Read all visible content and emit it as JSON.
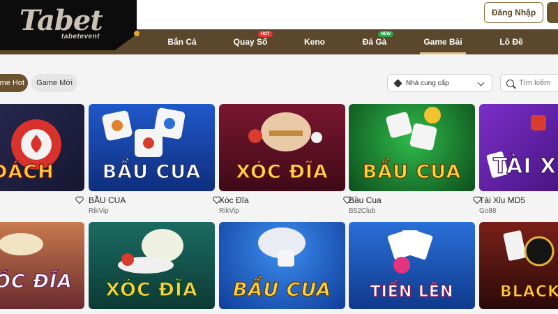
{
  "brand": {
    "logo_text": "Tabet",
    "logo_sub": "tabetevent"
  },
  "header": {
    "login_label": "Đăng Nhập"
  },
  "nav": {
    "items": [
      {
        "label": "Bắn Cá"
      },
      {
        "label": "Quay Số",
        "badge": "HOT"
      },
      {
        "label": "Keno"
      },
      {
        "label": "Đá Gà",
        "badge": "NEW"
      },
      {
        "label": "Game Bài",
        "active": true
      },
      {
        "label": "Lô Đề"
      }
    ]
  },
  "filters": {
    "chips": [
      "Game Hot",
      "Game Mới"
    ],
    "provider_label": "Nhà cung cấp",
    "search_placeholder": "Tìm kiếm"
  },
  "games": [
    {
      "art_text": "DÁCH",
      "name": "",
      "provider": ""
    },
    {
      "art_text": "BẦU CUA",
      "name": "BẦU CUA",
      "provider": "RikVip"
    },
    {
      "art_text": "XÓC ĐĨA",
      "name": "Xóc Đĩa",
      "provider": "RikVip"
    },
    {
      "art_text": "BẦU CUA",
      "name": "Bầu Cua",
      "provider": "B52Club"
    },
    {
      "art_text": "TÀI X MD",
      "name": "Tài Xỉu MD5",
      "provider": "Go88"
    },
    {
      "art_text": "ÓC ĐĨA",
      "name": "",
      "provider": ""
    },
    {
      "art_text": "XÓC ĐĨA",
      "name": "",
      "provider": ""
    },
    {
      "art_text": "BẦU CUA",
      "name": "",
      "provider": ""
    },
    {
      "art_text": "TIẾN LÊN",
      "name": "",
      "provider": ""
    },
    {
      "art_text": "BLACKJA",
      "name": "",
      "provider": ""
    }
  ],
  "icons": {
    "heart": "heart-icon",
    "search": "search-icon",
    "provider": "cube-icon",
    "chevron": "chevron-down-icon"
  },
  "colors": {
    "brand_brown": "#5b472b",
    "accent": "#6b5330"
  }
}
